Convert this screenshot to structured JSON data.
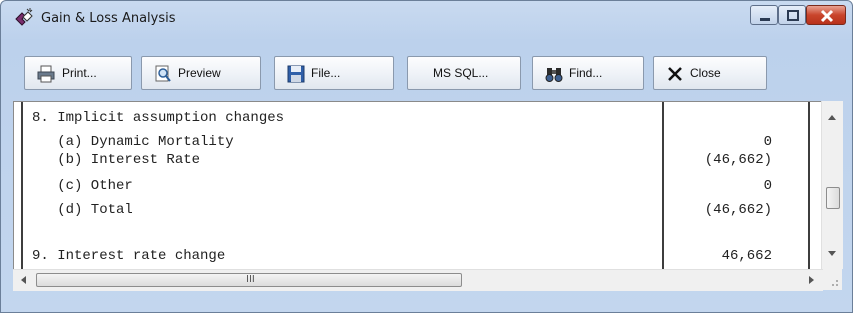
{
  "window": {
    "title": "Gain & Loss Analysis",
    "app_icon": "puzzle-pieces-icon",
    "caption_buttons": [
      "minimize-icon",
      "maximize-icon",
      "close-icon"
    ]
  },
  "toolbar": {
    "print_label": "Print...",
    "preview_label": "Preview",
    "file_label": "File...",
    "mssql_label": "MS SQL...",
    "find_label": "Find...",
    "close_label": "Close",
    "icons": [
      "printer-icon",
      "preview-icon",
      "floppy-disk-icon",
      "binoculars-icon",
      "close-x-icon"
    ]
  },
  "report": {
    "lines": [
      {
        "text": "8. Implicit assumption changes",
        "value": ""
      },
      {
        "text": "   (a) Dynamic Mortality",
        "value": "0"
      },
      {
        "text": "   (b) Interest Rate",
        "value": "(46,662)"
      },
      {
        "text": "   (c) Other",
        "value": "0"
      },
      {
        "text": "   (d) Total",
        "value": "(46,662)"
      },
      {
        "text": "",
        "value": ""
      },
      {
        "text": "9. Interest rate change",
        "value": "46,662"
      }
    ]
  },
  "scrollbar": {
    "horizontal_grip": "III"
  },
  "colors": {
    "window_frame": "#bcd1ec",
    "close_button": "#c9452c"
  }
}
